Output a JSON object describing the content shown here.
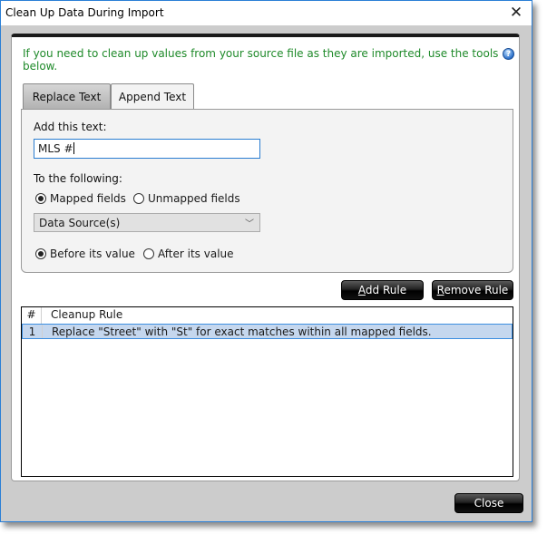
{
  "window": {
    "title": "Clean Up Data During Import",
    "close_icon": "close-x-icon"
  },
  "intro": {
    "text": "If you need to clean up values from your source file as they are imported, use the tools below.",
    "help_icon": "help-question-icon",
    "help_glyph": "?"
  },
  "tabs": [
    {
      "label": "Replace Text",
      "active": false
    },
    {
      "label": "Append Text",
      "active": true
    }
  ],
  "append": {
    "add_label": "Add this text:",
    "text_value": "MLS #",
    "to_label": "To the following:",
    "field_scope": [
      {
        "label": "Mapped fields",
        "checked": true
      },
      {
        "label": "Unmapped fields",
        "checked": false
      }
    ],
    "source_select": {
      "value": "Data Source(s)",
      "icon": "chevron-down-icon",
      "glyph": "﹀"
    },
    "position": [
      {
        "label": "Before its value",
        "checked": true
      },
      {
        "label": "After its value",
        "checked": false
      }
    ]
  },
  "buttons": {
    "add_rule": {
      "mnemonic": "A",
      "rest": "dd Rule"
    },
    "remove_rule": {
      "mnemonic": "R",
      "rest": "emove Rule"
    },
    "close": "Close"
  },
  "rules_table": {
    "columns": [
      "#",
      "Cleanup Rule"
    ],
    "rows": [
      {
        "num": "1",
        "rule": "Replace \"Street\" with \"St\" for exact matches within all mapped fields.",
        "selected": true
      }
    ]
  }
}
